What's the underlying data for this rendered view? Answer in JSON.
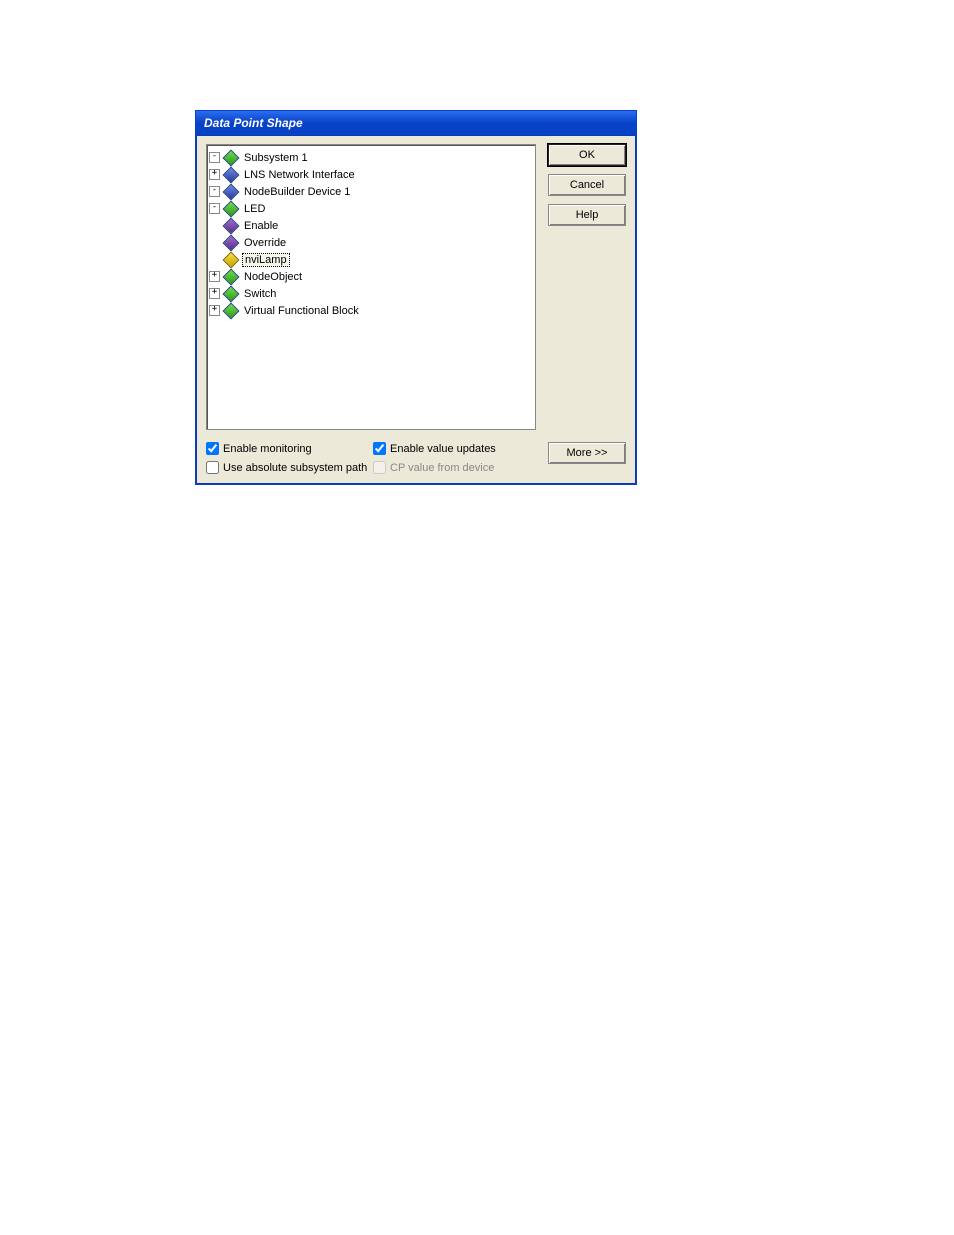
{
  "dialog": {
    "title": "Data Point Shape"
  },
  "buttons": {
    "ok": "OK",
    "cancel": "Cancel",
    "help": "Help",
    "more": "More >>"
  },
  "checkboxes": {
    "enable_monitoring": "Enable monitoring",
    "use_absolute_path": "Use absolute subsystem path",
    "enable_value_updates": "Enable value updates",
    "cp_value_from_device": "CP value from device"
  },
  "tree": {
    "root": {
      "label": "Subsystem 1",
      "children": [
        {
          "label": "LNS Network Interface"
        },
        {
          "label": "NodeBuilder Device 1",
          "children": [
            {
              "label": "LED",
              "children": [
                {
                  "label": "Enable"
                },
                {
                  "label": "Override"
                },
                {
                  "label": "nviLamp",
                  "selected": true
                }
              ]
            },
            {
              "label": "NodeObject"
            },
            {
              "label": "Switch"
            },
            {
              "label": "Virtual Functional Block"
            }
          ]
        }
      ]
    }
  }
}
